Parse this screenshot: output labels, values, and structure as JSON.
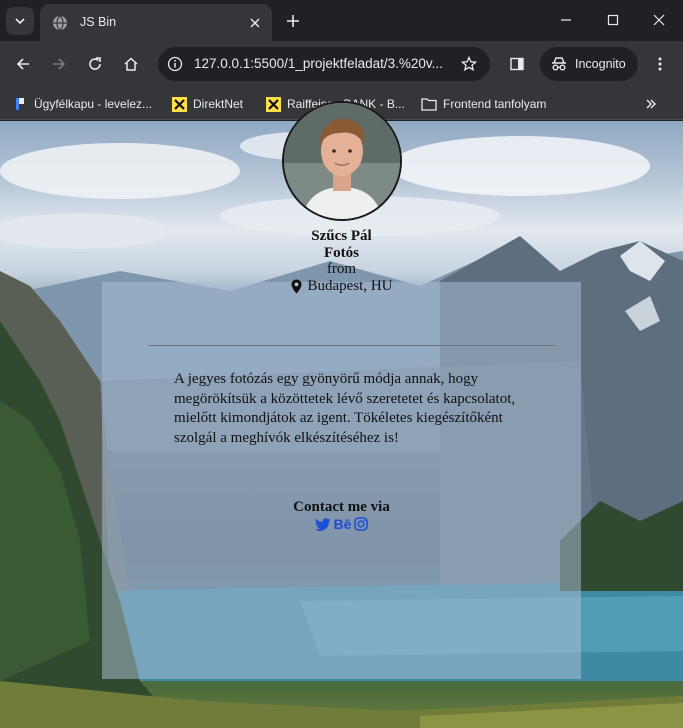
{
  "browser": {
    "tab_title": "JS Bin",
    "url": "127.0.0.1:5500/1_projektfeladat/3.%20v...",
    "incognito_label": "Incognito",
    "bookmarks": [
      {
        "label": "Ügyfélkapu - levelez...",
        "icon": "bookmark-flag-icon"
      },
      {
        "label": "DirektNet",
        "icon": "raiffeisen-icon"
      },
      {
        "label": "Raiffeisen BANK - B...",
        "icon": "raiffeisen-icon"
      },
      {
        "label": "Frontend tanfolyam",
        "icon": "folder-icon"
      }
    ]
  },
  "profile": {
    "name": "Szűcs Pál",
    "role": "Fotós",
    "from_label": "from",
    "location": "Budapest, HU",
    "bio": "A jegyes fotózás egy gyönyörű módja annak, hogy megörökítsük a közöttetek lévő szeretetet és kapcsolatot, mielőtt kimondjátok az igent. Tökéletes kiegészítőként szolgál a meghívók elkészítéséhez is!",
    "contact_label": "Contact me via",
    "socials": [
      "twitter-icon",
      "behance-icon",
      "instagram-icon"
    ],
    "behance_text": "Bē"
  },
  "colors": {
    "chrome_dark": "#202124",
    "chrome_toolbar": "#35363a",
    "social_blue": "#1d4ed8"
  }
}
